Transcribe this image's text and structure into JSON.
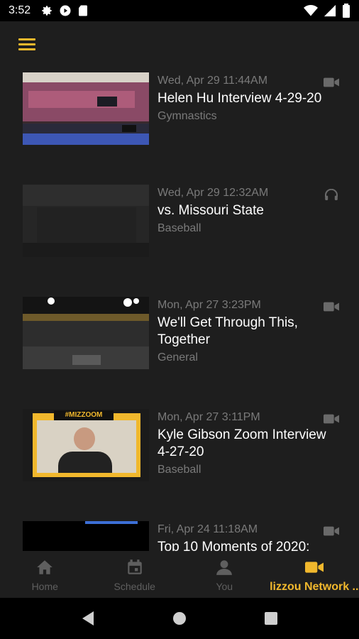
{
  "status_bar": {
    "time": "3:52",
    "left_icons": [
      "gear-icon",
      "play-icon",
      "sd-card-icon"
    ],
    "right_icons": [
      "wifi-icon",
      "signal-icon",
      "battery-icon"
    ]
  },
  "app_bar": {
    "menu_icon": "hamburger-menu-icon",
    "accent": "#f1b82d"
  },
  "feed": [
    {
      "date": "Wed, Apr 29 11:44AM",
      "title": "Helen Hu Interview 4-29-20",
      "sport": "Gymnastics",
      "media": "video-camera-icon"
    },
    {
      "date": "Wed, Apr 29 12:32AM",
      "title": "vs. Missouri State",
      "sport": "Baseball",
      "media": "headphones-icon"
    },
    {
      "date": "Mon, Apr 27 3:23PM",
      "title": "We'll Get Through This, Together",
      "sport": "General",
      "media": "video-camera-icon"
    },
    {
      "date": "Mon, Apr 27 3:11PM",
      "title": "Kyle Gibson Zoom Interview 4-27-20",
      "sport": "Baseball",
      "media": "video-camera-icon",
      "thumb_text": "#MIZZOOM"
    },
    {
      "date": "Fri, Apr 24 11:18AM",
      "title": "Top 10 Moments of 2020:",
      "sport": "",
      "media": "video-camera-icon"
    }
  ],
  "bottom_nav": [
    {
      "label": "Home",
      "icon": "home-icon",
      "active": false
    },
    {
      "label": "Schedule",
      "icon": "calendar-icon",
      "active": false
    },
    {
      "label": "You",
      "icon": "person-icon",
      "active": false
    },
    {
      "label": "lizzou Network ..",
      "icon": "video-camera-icon",
      "active": true
    }
  ],
  "system_nav": [
    "back-icon",
    "home-circle-icon",
    "recents-icon"
  ],
  "colors": {
    "background": "#1e1e1e",
    "accent": "#f1b82d",
    "muted_text": "#7a7a7a",
    "inactive_nav": "#5f5f5f"
  }
}
